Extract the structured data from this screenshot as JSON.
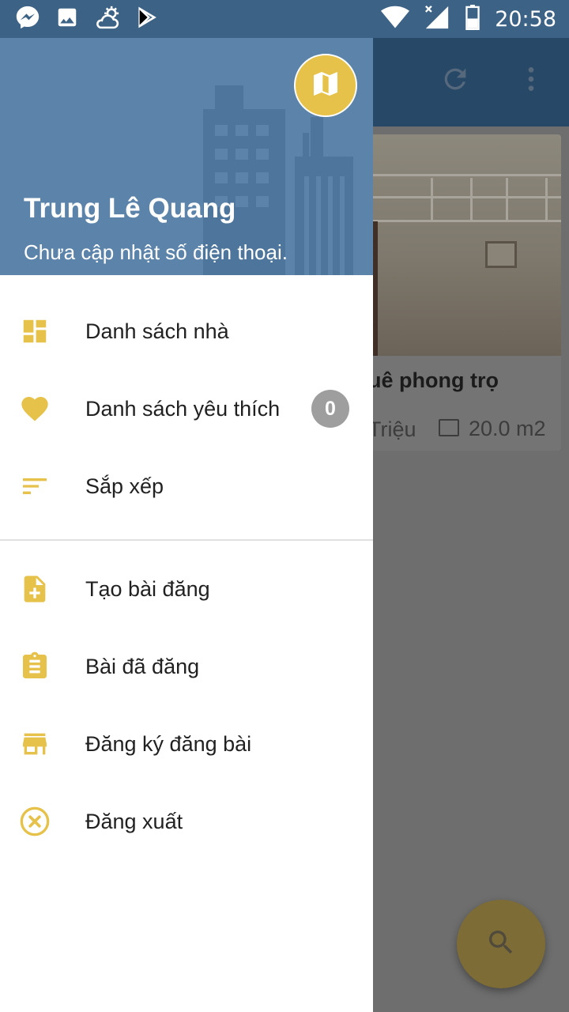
{
  "status_bar": {
    "time": "20:58",
    "left_icons": [
      "messenger-icon",
      "gallery-icon",
      "weather-icon",
      "play-store-icon"
    ],
    "right_icons": [
      "wifi-icon",
      "signal-icon",
      "battery-icon"
    ]
  },
  "drawer": {
    "header": {
      "user_name": "Trung Lê Quang",
      "phone_status": "Chưa cập nhật số điện thoại.",
      "map_icon": "map-icon"
    },
    "menu_primary": [
      {
        "label": "Danh sách nhà",
        "icon": "dashboard-icon"
      },
      {
        "label": "Danh sách yêu thích",
        "icon": "heart-icon",
        "badge": "0"
      },
      {
        "label": "Sắp xếp",
        "icon": "sort-icon"
      }
    ],
    "menu_secondary": [
      {
        "label": "Tạo bài đăng",
        "icon": "note-add-icon"
      },
      {
        "label": "Bài đã đăng",
        "icon": "clipboard-icon"
      },
      {
        "label": "Đăng ký đăng bài",
        "icon": "store-icon"
      },
      {
        "label": "Đăng xuất",
        "icon": "close-circle-icon"
      }
    ]
  },
  "background": {
    "toolbar_icons": [
      "refresh-icon",
      "more-vert-icon"
    ],
    "card": {
      "title_fragment": "uê phong trọ",
      "price_fragment": "Triệu",
      "area": "20.0 m2"
    },
    "fab_icon": "search-icon"
  },
  "colors": {
    "status_bar": "#3c6286",
    "drawer_header": "#5c84aa",
    "accent": "#e7c24a",
    "text": "#212121",
    "badge": "#9e9e9e"
  }
}
